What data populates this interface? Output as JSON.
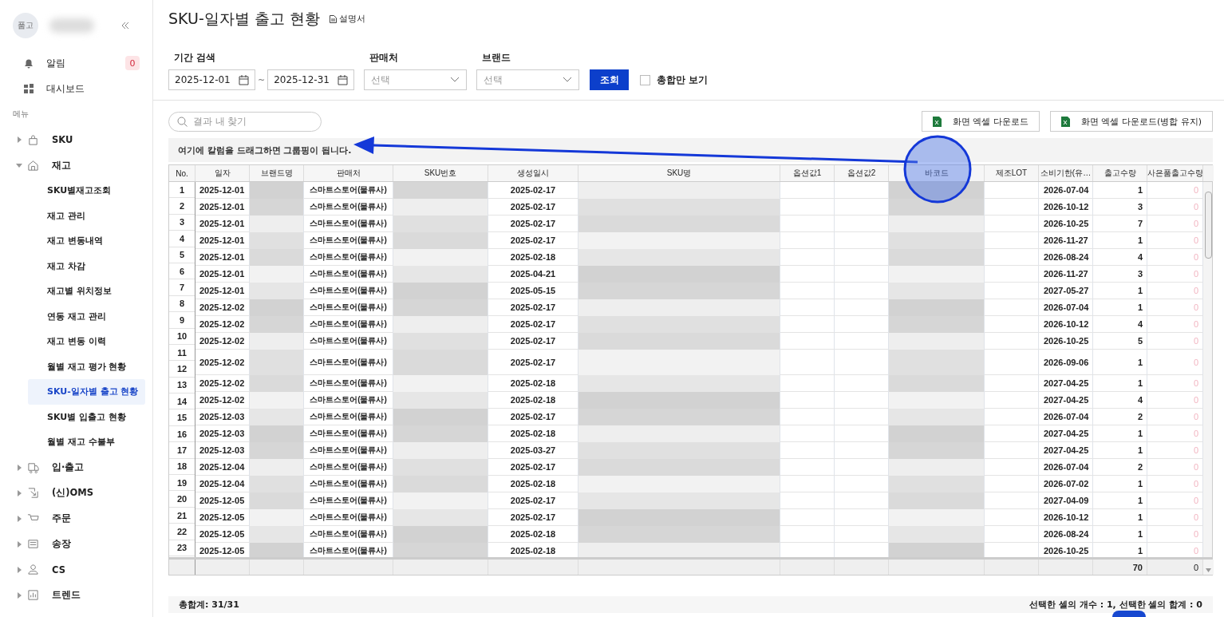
{
  "sidebar": {
    "avatar": "품고",
    "alerts": {
      "label": "알림",
      "count": "0"
    },
    "dashboard": "대시보드",
    "section": "메뉴",
    "items": [
      {
        "label": "SKU",
        "expanded": false
      },
      {
        "label": "재고",
        "expanded": true,
        "children": [
          {
            "label": "SKU별재고조회",
            "selected": false
          },
          {
            "label": "재고 관리",
            "selected": false
          },
          {
            "label": "재고 변동내역",
            "selected": false
          },
          {
            "label": "재고 차감",
            "selected": false
          },
          {
            "label": "재고별 위치정보",
            "selected": false
          },
          {
            "label": "연동 재고 관리",
            "selected": false
          },
          {
            "label": "재고 변동 이력",
            "selected": false
          },
          {
            "label": "월별 재고 평가 현황",
            "selected": false
          },
          {
            "label": "SKU-일자별 출고 현황",
            "selected": true
          },
          {
            "label": "SKU별 입출고 현황",
            "selected": false
          },
          {
            "label": "월별 재고 수불부",
            "selected": false
          }
        ]
      },
      {
        "label": "입·출고",
        "expanded": false
      },
      {
        "label": "(신)OMS",
        "expanded": false
      },
      {
        "label": "주문",
        "expanded": false
      },
      {
        "label": "송장",
        "expanded": false
      },
      {
        "label": "CS",
        "expanded": false
      },
      {
        "label": "트렌드",
        "expanded": false
      }
    ]
  },
  "page": {
    "title": "SKU-일자별 출고 현황",
    "manual_link": "설명서"
  },
  "filters": {
    "period": {
      "label": "기간 검색",
      "from": "2025-12-01",
      "separator": "~",
      "to": "2025-12-31"
    },
    "seller": {
      "label": "판매처",
      "placeholder": "선택"
    },
    "brand": {
      "label": "브랜드",
      "placeholder": "선택"
    },
    "search_button": "조회",
    "totals_only": {
      "label": "총합만 보기",
      "checked": false
    }
  },
  "result_search": {
    "placeholder": "결과 내 찾기"
  },
  "export_buttons": [
    "화면 엑셀 다운로드",
    "화면 엑셀 다운로드(병합 유지)"
  ],
  "group_hint": "여기에 칼럼을 드래그하면 그룹핑이 됩니다.",
  "annotation": {
    "kind": "circle-arrow"
  },
  "table": {
    "columns": [
      {
        "label": "No.",
        "kind": "number"
      },
      {
        "label": "일자",
        "kind": "date"
      },
      {
        "label": "브랜드명",
        "kind": "blurred"
      },
      {
        "label": "판매처",
        "kind": "seller"
      },
      {
        "label": "SKU번호",
        "kind": "blurred"
      },
      {
        "label": "생성일시",
        "kind": "created"
      },
      {
        "label": "SKU명",
        "kind": "blurred"
      },
      {
        "label": "옵션값1",
        "kind": "empty"
      },
      {
        "label": "옵션값2",
        "kind": "empty"
      },
      {
        "label": "바코드",
        "kind": "blurred"
      },
      {
        "label": "제조LOT",
        "kind": "empty"
      },
      {
        "label": "소비기한(유…",
        "kind": "expiry"
      },
      {
        "label": "출고수량",
        "kind": "qty"
      },
      {
        "label": "사은품출고수량",
        "kind": "gift"
      }
    ],
    "row_numbers": [
      "1",
      "2",
      "3",
      "4",
      "5",
      "6",
      "7",
      "8",
      "9",
      "10",
      "11",
      "12",
      "13",
      "14",
      "15",
      "16",
      "17",
      "18",
      "19",
      "20",
      "21",
      "22",
      "23"
    ],
    "rows": [
      {
        "date": "2025-12-01",
        "seller": "스마트스토어(물류사)",
        "created": "2025-02-17",
        "expiry": "2026-07-04",
        "qty": "1",
        "gift": "0",
        "tall": false
      },
      {
        "date": "2025-12-01",
        "seller": "스마트스토어(물류사)",
        "created": "2025-02-17",
        "expiry": "2026-10-12",
        "qty": "3",
        "gift": "0",
        "tall": false
      },
      {
        "date": "2025-12-01",
        "seller": "스마트스토어(물류사)",
        "created": "2025-02-17",
        "expiry": "2026-10-25",
        "qty": "7",
        "gift": "0",
        "tall": false
      },
      {
        "date": "2025-12-01",
        "seller": "스마트스토어(물류사)",
        "created": "2025-02-17",
        "expiry": "2026-11-27",
        "qty": "1",
        "gift": "0",
        "tall": false
      },
      {
        "date": "2025-12-01",
        "seller": "스마트스토어(물류사)",
        "created": "2025-02-18",
        "expiry": "2026-08-24",
        "qty": "4",
        "gift": "0",
        "tall": false
      },
      {
        "date": "2025-12-01",
        "seller": "스마트스토어(물류사)",
        "created": "2025-04-21",
        "expiry": "2026-11-27",
        "qty": "3",
        "gift": "0",
        "tall": false
      },
      {
        "date": "2025-12-01",
        "seller": "스마트스토어(물류사)",
        "created": "2025-05-15",
        "expiry": "2027-05-27",
        "qty": "1",
        "gift": "0",
        "tall": false
      },
      {
        "date": "2025-12-02",
        "seller": "스마트스토어(물류사)",
        "created": "2025-02-17",
        "expiry": "2026-07-04",
        "qty": "1",
        "gift": "0",
        "tall": false
      },
      {
        "date": "2025-12-02",
        "seller": "스마트스토어(물류사)",
        "created": "2025-02-17",
        "expiry": "2026-10-12",
        "qty": "4",
        "gift": "0",
        "tall": false
      },
      {
        "date": "2025-12-02",
        "seller": "스마트스토어(물류사)",
        "created": "2025-02-17",
        "expiry": "2026-10-25",
        "qty": "5",
        "gift": "0",
        "tall": false
      },
      {
        "date": "2025-12-02",
        "seller": "스마트스토어(물류사)",
        "created": "2025-02-17",
        "expiry": "2026-09-06",
        "qty": "1",
        "gift": "0",
        "tall": true
      },
      {
        "date": "2025-12-02",
        "seller": "스마트스토어(물류사)",
        "created": "2025-02-18",
        "expiry": "2027-04-25",
        "qty": "1",
        "gift": "0",
        "tall": false
      },
      {
        "date": "2025-12-02",
        "seller": "스마트스토어(물류사)",
        "created": "2025-02-18",
        "expiry": "2027-04-25",
        "qty": "4",
        "gift": "0",
        "tall": false
      },
      {
        "date": "2025-12-03",
        "seller": "스마트스토어(물류사)",
        "created": "2025-02-17",
        "expiry": "2026-07-04",
        "qty": "2",
        "gift": "0",
        "tall": false
      },
      {
        "date": "2025-12-03",
        "seller": "스마트스토어(물류사)",
        "created": "2025-02-18",
        "expiry": "2027-04-25",
        "qty": "1",
        "gift": "0",
        "tall": false
      },
      {
        "date": "2025-12-03",
        "seller": "스마트스토어(물류사)",
        "created": "2025-03-27",
        "expiry": "2027-04-25",
        "qty": "1",
        "gift": "0",
        "tall": false
      },
      {
        "date": "2025-12-04",
        "seller": "스마트스토어(물류사)",
        "created": "2025-02-17",
        "expiry": "2026-07-04",
        "qty": "2",
        "gift": "0",
        "tall": false
      },
      {
        "date": "2025-12-04",
        "seller": "스마트스토어(물류사)",
        "created": "2025-02-18",
        "expiry": "2026-07-02",
        "qty": "1",
        "gift": "0",
        "tall": false
      },
      {
        "date": "2025-12-05",
        "seller": "스마트스토어(물류사)",
        "created": "2025-02-17",
        "expiry": "2027-04-09",
        "qty": "1",
        "gift": "0",
        "tall": false
      },
      {
        "date": "2025-12-05",
        "seller": "스마트스토어(물류사)",
        "created": "2025-02-17",
        "expiry": "2026-10-12",
        "qty": "1",
        "gift": "0",
        "tall": false
      },
      {
        "date": "2025-12-05",
        "seller": "스마트스토어(물류사)",
        "created": "2025-02-18",
        "expiry": "2026-08-24",
        "qty": "1",
        "gift": "0",
        "tall": false
      },
      {
        "date": "2025-12-05",
        "seller": "스마트스토어(물류사)",
        "created": "2025-02-18",
        "expiry": "2026-10-25",
        "qty": "1",
        "gift": "0",
        "tall": false
      }
    ],
    "totals": {
      "qty": "70",
      "gift": "0"
    }
  },
  "status_bar": {
    "total": "총합계: 31/31",
    "selection": "선택한 셀의 개수 : 1, 선택한 셀의 합계 : 0"
  }
}
